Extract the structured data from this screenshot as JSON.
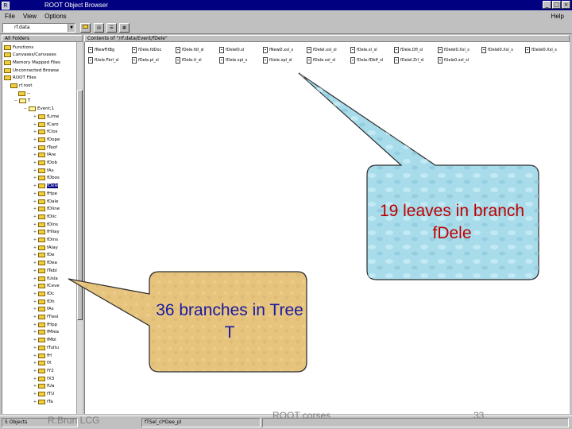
{
  "window": {
    "title": "ROOT Object Browser",
    "menu": [
      "File",
      "View",
      "Options"
    ],
    "help": "Help"
  },
  "toolbar": {
    "path_value": "rf.data",
    "tools": [
      "up",
      "list",
      "detail",
      "img",
      "new"
    ]
  },
  "left_pane": {
    "header": "All Folders",
    "items": [
      "Functions",
      "Canvases/Canvases",
      "Memory Mapped Files",
      "Unconnected Browse",
      "ROOT Files",
      "rf.root",
      "--",
      "T",
      "Event;1",
      "fLime",
      "fCaro",
      "fClos",
      "fDope",
      "fTeof",
      "fAre",
      "fDob",
      "fAs",
      "fDbos",
      "fDele",
      "fHpe",
      "fDale",
      "fDline",
      "fDlic",
      "fDlns",
      "fHliay",
      "fDins",
      "fAlay",
      "fDe",
      "fDea",
      "fTebl",
      "fUsla",
      "fCeve",
      "fDc",
      "fDh",
      "fAs",
      "fTiesl",
      "fHpp",
      "fMlea",
      "fMbl",
      "fTultu",
      "fH",
      "fX",
      "fY2",
      "fX3",
      "fUa",
      "fTU",
      "fTa"
    ]
  },
  "right_pane": {
    "header": "Contents of \"/rf.data/Event/fDele\"",
    "leaves": [
      "fNewFitBg",
      "fDele.fdDoc",
      "fDele.fdl_sl",
      "fDelel0.sl",
      "fNewD.xsl_s",
      "fDelel.xsl_sl",
      "fDele.xl_sl",
      "fDele.Dfl_sl",
      "fDelel0.Xsl_s",
      "fDelel0.Xsl_s",
      "fDelel0.Xsl_s",
      "fUele.Fbrl_sl",
      "fDele.pl_sl",
      "fDele.tl_sl",
      "fDele.xpl_s",
      "fUele.xpl_sl",
      "fDele.sxl_sl",
      "fDele.fDblf_sl",
      "fDelel.Zrl_sl",
      "fUele0.xsl_sl"
    ]
  },
  "statusbar": {
    "object_count": "5 Objects",
    "selected_leaf": "fTSel_cl*Dee_pl"
  },
  "slide_footer": {
    "author": "R.Brun LCG",
    "course": "ROOT corses",
    "page": "33"
  },
  "callouts": {
    "leaves": {
      "text": "19 leaves in branch fDele",
      "color": "#c00000",
      "fill": "#a8dceb"
    },
    "branches": {
      "text": "36 branches in Tree T",
      "color": "#1a1aa0",
      "fill": "#e8c880"
    }
  }
}
